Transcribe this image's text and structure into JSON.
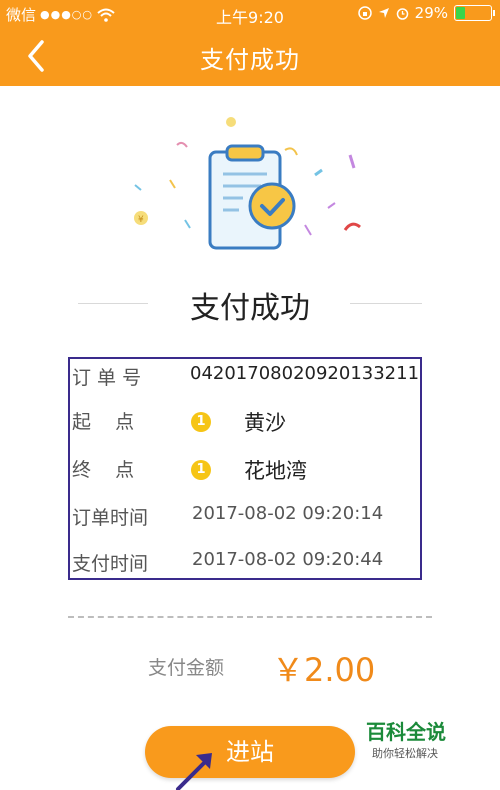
{
  "status_bar": {
    "carrier": "微信",
    "signal": "●●●○○",
    "time": "上午9:20",
    "battery_text": "29%",
    "battery_level": 0.29
  },
  "header": {
    "title": "支付成功"
  },
  "success": {
    "heading": "支付成功"
  },
  "order": {
    "order_no_label": "订 单 号",
    "order_no": "04201708020920133211",
    "start_label": "起    点",
    "start_station": "黄沙",
    "start_line": "1",
    "end_label": "终    点",
    "end_station": "花地湾",
    "end_line": "1",
    "order_time_label": "订单时间",
    "order_time": "2017-08-02 09:20:14",
    "pay_time_label": "支付时间",
    "pay_time": "2017-08-02 09:20:44"
  },
  "payment": {
    "label": "支付金额",
    "amount": "￥2.00"
  },
  "action": {
    "enter_label": "进站"
  },
  "watermark": {
    "title": "百科全说",
    "subtitle": "助你轻松解决"
  },
  "colors": {
    "primary": "#f99a1c",
    "amount": "#f08a1a",
    "box_border": "#3a2b8c",
    "coin": "#f6c516"
  }
}
